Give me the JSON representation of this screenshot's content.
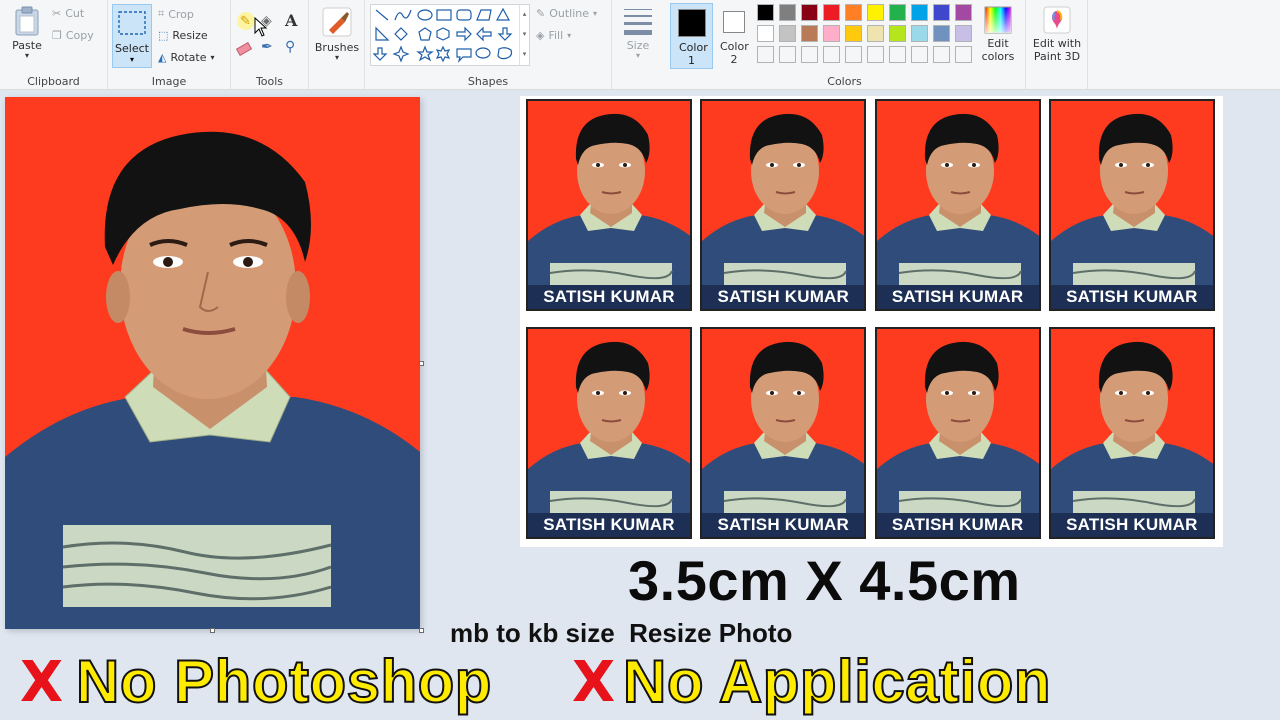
{
  "ribbon": {
    "clipboard": {
      "label": "Clipboard",
      "paste": "Paste",
      "cut": "Cut",
      "copy": "Copy"
    },
    "image": {
      "label": "Image",
      "select": "Select",
      "crop": "Crop",
      "resize": "Resize",
      "rotate": "Rotate"
    },
    "tools": {
      "label": "Tools"
    },
    "brushes": {
      "label": "Brushes"
    },
    "shapes": {
      "label": "Shapes",
      "outline": "Outline",
      "fill": "Fill"
    },
    "size": {
      "label": "Size"
    },
    "colors": {
      "label": "Colors",
      "color1": "Color 1",
      "color2": "Color 2",
      "edit_colors": "Edit colors",
      "edit_with_3d": "Edit with Paint 3D",
      "palette_row1": [
        "#000000",
        "#7f7f7f",
        "#880015",
        "#ed1c24",
        "#ff7f27",
        "#fff200",
        "#22b14c",
        "#00a2e8",
        "#3f48cc",
        "#a349a4"
      ],
      "palette_row2": [
        "#ffffff",
        "#c3c3c3",
        "#b97a57",
        "#ffaec9",
        "#ffc90e",
        "#efe4b0",
        "#b5e61d",
        "#99d9ea",
        "#7092be",
        "#c8bfe7"
      ]
    }
  },
  "canvas": {
    "photo_bg": "#ff3b1f",
    "sweater": "#2f4c7a"
  },
  "thumbnails": {
    "name_label": "SATISH KUMAR",
    "rows": 2,
    "cols": 4
  },
  "overlay": {
    "size_text": "3.5cm X 4.5cm",
    "sub_text": "mb to kb size  Resize Photo",
    "headline1": "No Photoshop",
    "headline2": "No Application",
    "x_mark": "X"
  }
}
